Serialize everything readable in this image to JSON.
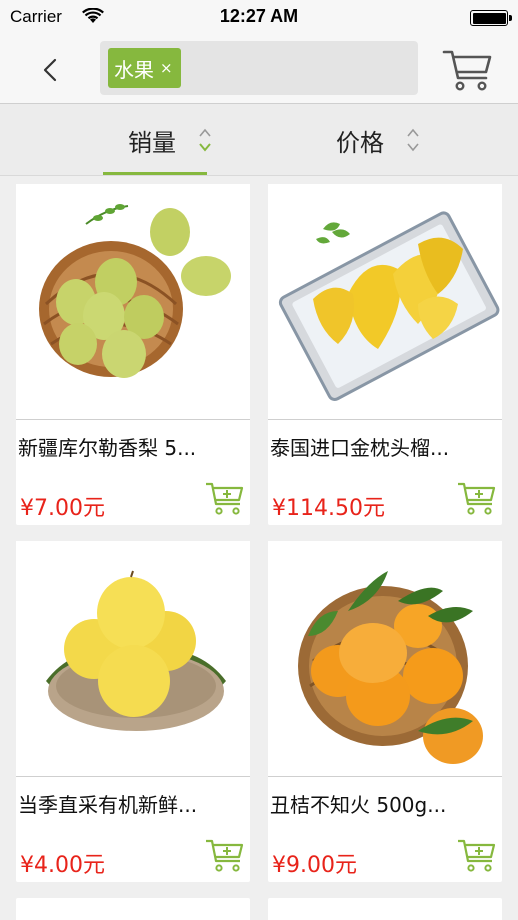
{
  "status": {
    "carrier": "Carrier",
    "time": "12:27 AM"
  },
  "nav": {
    "tag_label": "水果",
    "tag_close": "×"
  },
  "sort": {
    "sales_label": "销量",
    "price_label": "价格"
  },
  "colors": {
    "accent": "#86b83e",
    "price": "#e8231a"
  },
  "products": [
    {
      "name": "新疆库尔勒香梨 5...",
      "price": "¥7.00元",
      "image": "pears-in-basket"
    },
    {
      "name": "泰国进口金枕头榴...",
      "price": "¥114.50元",
      "image": "durian-on-tray"
    },
    {
      "name": "当季直采有机新鲜...",
      "price": "¥4.00元",
      "image": "yellow-pears-on-plate"
    },
    {
      "name": "丑桔不知火 500g...",
      "price": "¥9.00元",
      "image": "tangerines-in-basket"
    }
  ]
}
